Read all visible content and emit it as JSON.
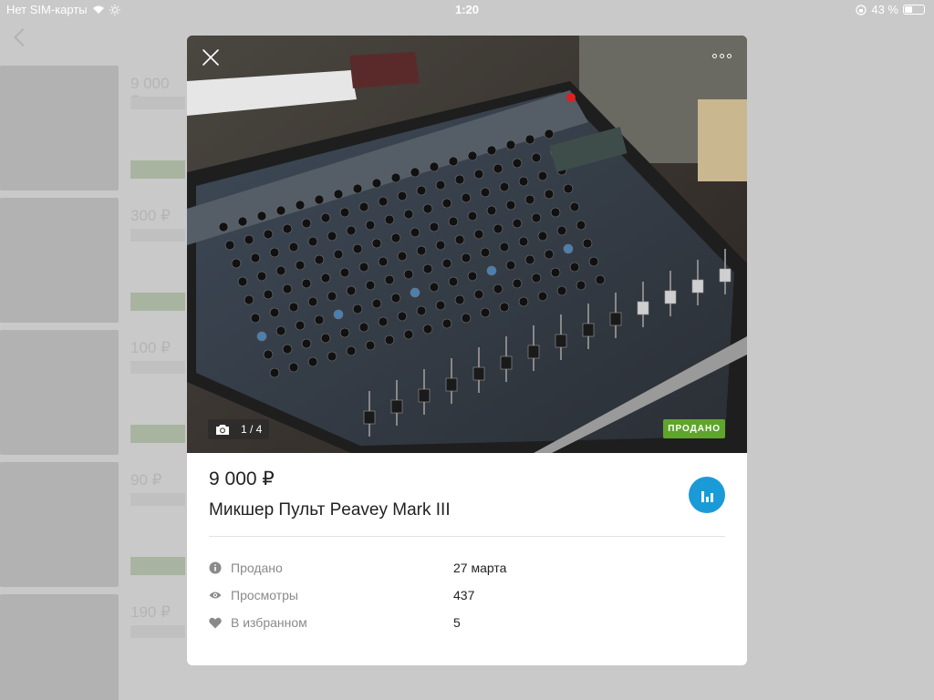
{
  "status_bar": {
    "carrier": "Нет SIM-карты",
    "time": "1:20",
    "battery": "43 %",
    "battery_level": 0.43
  },
  "background_list": {
    "prices": [
      "9 000 ₽",
      "300 ₽",
      "100 ₽",
      "90 ₽",
      "190 ₽"
    ]
  },
  "listing": {
    "photo_counter": "1 / 4",
    "sold_badge": "ПРОДАНО",
    "price": "9 000 ₽",
    "title": "Микшер Пульт Peavey Mark III",
    "meta": [
      {
        "icon": "info-icon",
        "label": "Продано",
        "value": "27 марта"
      },
      {
        "icon": "eye-icon",
        "label": "Просмотры",
        "value": "437"
      },
      {
        "icon": "heart-icon",
        "label": "В избранном",
        "value": "5"
      }
    ]
  },
  "colors": {
    "sold_badge": "#5fa52c",
    "stats_button": "#1a9bd7"
  }
}
